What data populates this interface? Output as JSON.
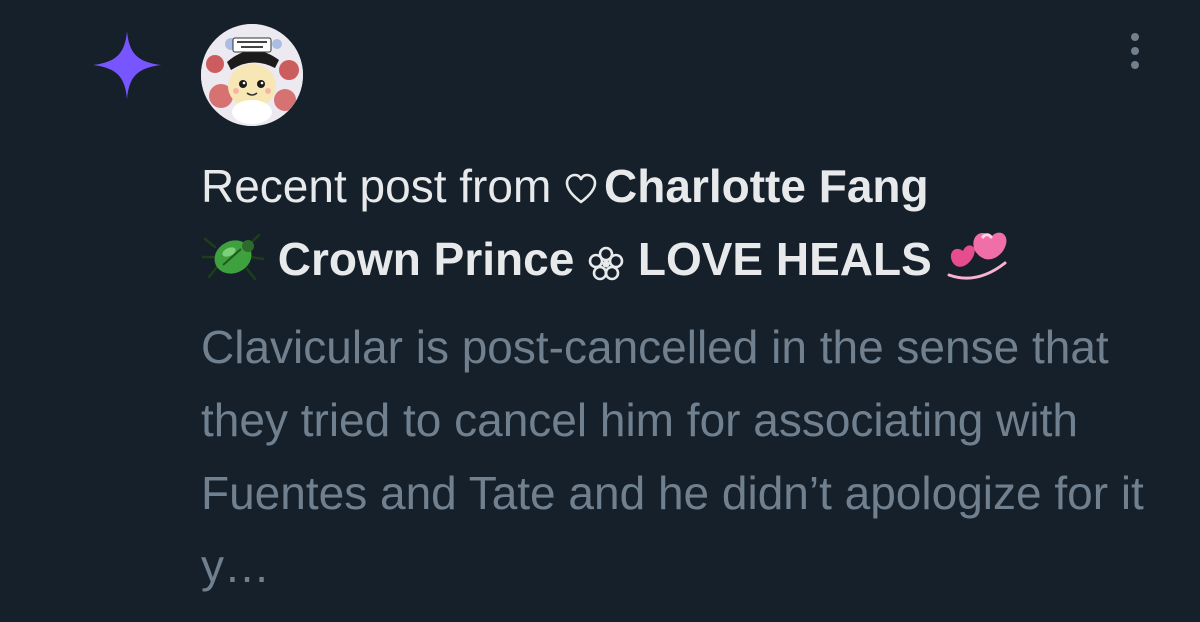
{
  "notification": {
    "type_icon": "sparkle-icon",
    "accent_color": "#7856ff",
    "avatar_icon": "profile-avatar",
    "more_icon": "vertical-ellipsis-icon",
    "prefix": "Recent post from",
    "author_name_part1": "Charlotte Fang",
    "author_name_part2": "Crown Prince",
    "author_name_part3": "LOVE HEALS",
    "name_emojis": [
      "heart-outline-icon",
      "beetle-icon",
      "flower-icon",
      "revolving-hearts-icon"
    ],
    "post_preview": "Clavicular is post-cancelled in the sense that they tried to cancel him for associating with Fuentes and Tate and he didn’t apologize for it y…"
  }
}
